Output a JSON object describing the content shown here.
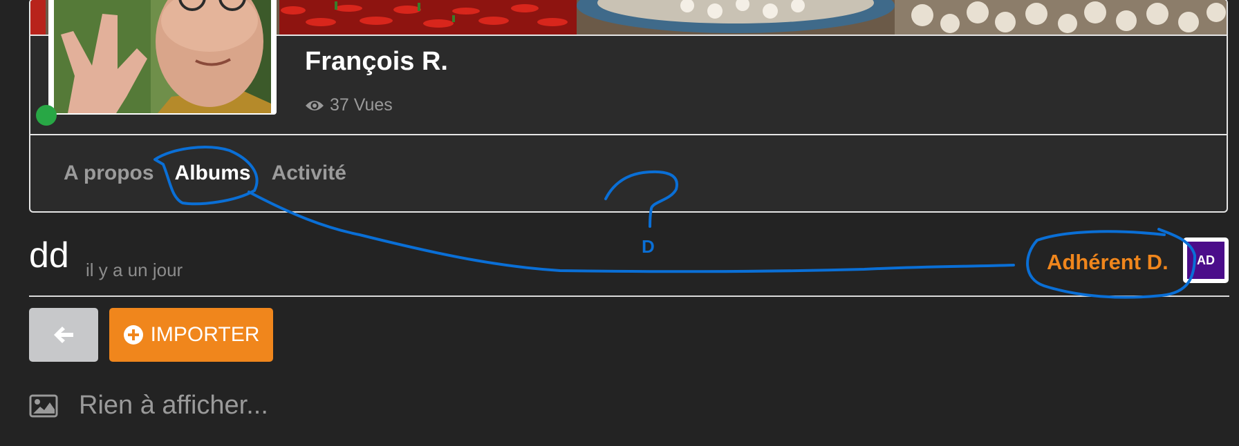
{
  "profile": {
    "name": "François R.",
    "views": "37 Vues",
    "online": true
  },
  "tabs": [
    {
      "label": "A propos",
      "active": false
    },
    {
      "label": "Albums",
      "active": true
    },
    {
      "label": "Activité",
      "active": false
    }
  ],
  "album": {
    "title": "dd",
    "time": "il y a un jour",
    "owner_name": "Adhérent D.",
    "owner_initials": "AD"
  },
  "actions": {
    "back_icon": "arrow-left-icon",
    "import_label": "IMPORTER",
    "import_icon": "plus-circle-icon"
  },
  "empty_state": {
    "icon": "image-icon",
    "text": "Rien à afficher..."
  },
  "annotations": {
    "question_letter": "D"
  },
  "colors": {
    "background": "#232323",
    "card": "#2b2b2b",
    "accent": "#f0861c",
    "online": "#28a745",
    "owner_avatar": "#4b0d8a",
    "annotation": "#0a6fd6"
  }
}
